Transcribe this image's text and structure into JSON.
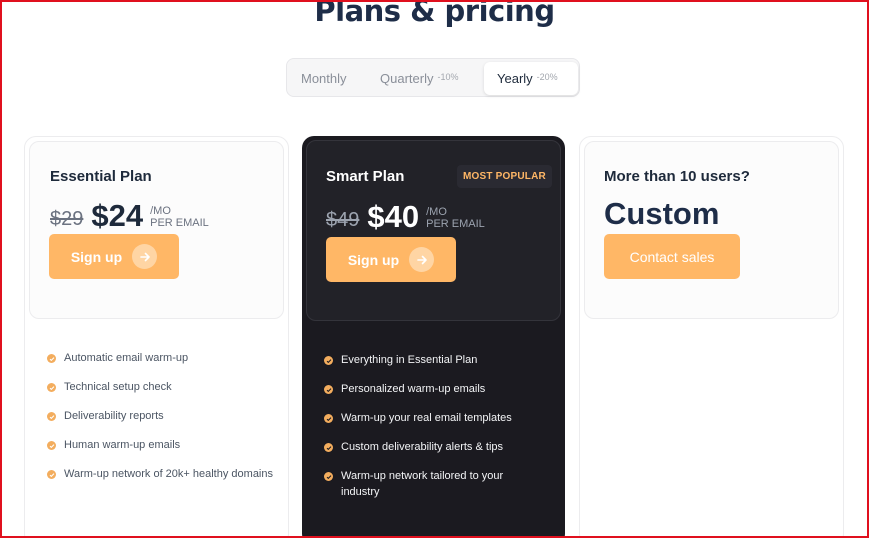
{
  "page": {
    "title": "Plans & pricing"
  },
  "billing_toggle": {
    "options": [
      {
        "label": "Monthly",
        "discount": ""
      },
      {
        "label": "Quarterly",
        "discount": "-10%"
      },
      {
        "label": "Yearly",
        "discount": "-20%"
      }
    ],
    "selected": "Yearly"
  },
  "plans": [
    {
      "name": "Essential Plan",
      "old_price": "$29",
      "price": "$24",
      "per_line1": "/MO",
      "per_line2": "PER EMAIL",
      "cta": "Sign up",
      "features": [
        "Automatic email warm-up",
        "Technical setup check",
        "Deliverability reports",
        "Human warm-up emails",
        "Warm-up network of 20k+ healthy domains"
      ]
    },
    {
      "name": "Smart Plan",
      "badge": "MOST POPULAR",
      "old_price": "$49",
      "price": "$40",
      "per_line1": "/MO",
      "per_line2": "PER EMAIL",
      "cta": "Sign up",
      "features": [
        "Everything in Essential Plan",
        "Personalized warm-up emails",
        "Warm-up your real email templates",
        "Custom deliverability alerts & tips",
        "Warm-up network tailored to your industry"
      ]
    },
    {
      "name": "More than 10 users?",
      "price": "Custom",
      "cta": "Contact sales"
    }
  ],
  "icons": {
    "cta_arrow": "arrow-right-icon",
    "feature_check": "check-circle-icon"
  },
  "colors": {
    "accent": "#ffb766",
    "dark_card": "#1b1a20",
    "title": "#1e2d48",
    "frame": "#e0101e"
  }
}
